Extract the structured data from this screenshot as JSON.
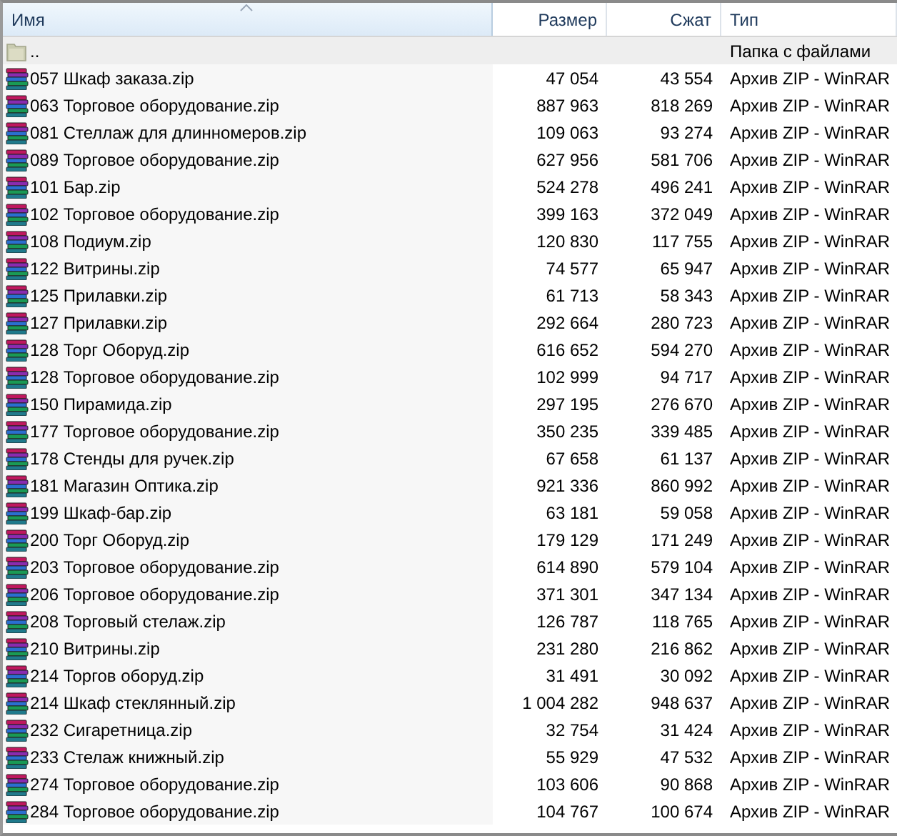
{
  "columns": [
    {
      "label": "Имя",
      "sorted": true
    },
    {
      "label": "Размер",
      "sorted": false
    },
    {
      "label": "Сжат",
      "sorted": false
    },
    {
      "label": "Тип",
      "sorted": false
    }
  ],
  "rows": [
    {
      "kind": "parent",
      "selected": true,
      "name": "..",
      "type": "Папка с файлами"
    },
    {
      "kind": "archive",
      "selected": false,
      "name": "057 Шкаф заказа.zip",
      "size": "47 054",
      "packed": "43 554",
      "type": "Архив ZIP - WinRAR"
    },
    {
      "kind": "archive",
      "selected": false,
      "name": "063 Торговое оборудование.zip",
      "size": "887 963",
      "packed": "818 269",
      "type": "Архив ZIP - WinRAR"
    },
    {
      "kind": "archive",
      "selected": false,
      "name": "081 Стеллаж для длинномеров.zip",
      "size": "109 063",
      "packed": "93 274",
      "type": "Архив ZIP - WinRAR"
    },
    {
      "kind": "archive",
      "selected": false,
      "name": "089 Торговое оборудование.zip",
      "size": "627 956",
      "packed": "581 706",
      "type": "Архив ZIP - WinRAR"
    },
    {
      "kind": "archive",
      "selected": false,
      "name": "101 Бар.zip",
      "size": "524 278",
      "packed": "496 241",
      "type": "Архив ZIP - WinRAR"
    },
    {
      "kind": "archive",
      "selected": false,
      "name": "102 Торговое оборудование.zip",
      "size": "399 163",
      "packed": "372 049",
      "type": "Архив ZIP - WinRAR"
    },
    {
      "kind": "archive",
      "selected": false,
      "name": "108 Подиум.zip",
      "size": "120 830",
      "packed": "117 755",
      "type": "Архив ZIP - WinRAR"
    },
    {
      "kind": "archive",
      "selected": false,
      "name": "122 Витрины.zip",
      "size": "74 577",
      "packed": "65 947",
      "type": "Архив ZIP - WinRAR"
    },
    {
      "kind": "archive",
      "selected": false,
      "name": "125 Прилавки.zip",
      "size": "61 713",
      "packed": "58 343",
      "type": "Архив ZIP - WinRAR"
    },
    {
      "kind": "archive",
      "selected": false,
      "name": "127 Прилавки.zip",
      "size": "292 664",
      "packed": "280 723",
      "type": "Архив ZIP - WinRAR"
    },
    {
      "kind": "archive",
      "selected": false,
      "name": "128 Торг Оборуд.zip",
      "size": "616 652",
      "packed": "594 270",
      "type": "Архив ZIP - WinRAR"
    },
    {
      "kind": "archive",
      "selected": false,
      "name": "128 Торговое оборудование.zip",
      "size": "102 999",
      "packed": "94 717",
      "type": "Архив ZIP - WinRAR"
    },
    {
      "kind": "archive",
      "selected": false,
      "name": "150 Пирамида.zip",
      "size": "297 195",
      "packed": "276 670",
      "type": "Архив ZIP - WinRAR"
    },
    {
      "kind": "archive",
      "selected": false,
      "name": "177 Торговое оборудование.zip",
      "size": "350 235",
      "packed": "339 485",
      "type": "Архив ZIP - WinRAR"
    },
    {
      "kind": "archive",
      "selected": false,
      "name": "178 Стенды для ручек.zip",
      "size": "67 658",
      "packed": "61 137",
      "type": "Архив ZIP - WinRAR"
    },
    {
      "kind": "archive",
      "selected": false,
      "name": "181 Магазин Оптика.zip",
      "size": "921 336",
      "packed": "860 992",
      "type": "Архив ZIP - WinRAR"
    },
    {
      "kind": "archive",
      "selected": false,
      "name": "199 Шкаф-бар.zip",
      "size": "63 181",
      "packed": "59 058",
      "type": "Архив ZIP - WinRAR"
    },
    {
      "kind": "archive",
      "selected": false,
      "name": "200 Торг Оборуд.zip",
      "size": "179 129",
      "packed": "171 249",
      "type": "Архив ZIP - WinRAR"
    },
    {
      "kind": "archive",
      "selected": false,
      "name": "203 Торговое оборудование.zip",
      "size": "614 890",
      "packed": "579 104",
      "type": "Архив ZIP - WinRAR"
    },
    {
      "kind": "archive",
      "selected": false,
      "name": "206 Торговое оборудование.zip",
      "size": "371 301",
      "packed": "347 134",
      "type": "Архив ZIP - WinRAR"
    },
    {
      "kind": "archive",
      "selected": false,
      "name": "208 Торговый стелаж.zip",
      "size": "126 787",
      "packed": "118 765",
      "type": "Архив ZIP - WinRAR"
    },
    {
      "kind": "archive",
      "selected": false,
      "name": "210 Витрины.zip",
      "size": "231 280",
      "packed": "216 862",
      "type": "Архив ZIP - WinRAR"
    },
    {
      "kind": "archive",
      "selected": false,
      "name": "214 Торгов оборуд.zip",
      "size": "31 491",
      "packed": "30 092",
      "type": "Архив ZIP - WinRAR"
    },
    {
      "kind": "archive",
      "selected": false,
      "name": "214 Шкаф стеклянный.zip",
      "size": "1 004 282",
      "packed": "948 637",
      "type": "Архив ZIP - WinRAR"
    },
    {
      "kind": "archive",
      "selected": false,
      "name": "232 Сигаретница.zip",
      "size": "32 754",
      "packed": "31 424",
      "type": "Архив ZIP - WinRAR"
    },
    {
      "kind": "archive",
      "selected": false,
      "name": "233 Стелаж книжный.zip",
      "size": "55 929",
      "packed": "47 532",
      "type": "Архив ZIP - WinRAR"
    },
    {
      "kind": "archive",
      "selected": false,
      "name": "274 Торговое оборудование.zip",
      "size": "103 606",
      "packed": "90 868",
      "type": "Архив ZIP - WinRAR"
    },
    {
      "kind": "archive",
      "selected": false,
      "name": "284 Торговое оборудование.zip",
      "size": "104 767",
      "packed": "100 674",
      "type": "Архив ZIP - WinRAR"
    }
  ]
}
